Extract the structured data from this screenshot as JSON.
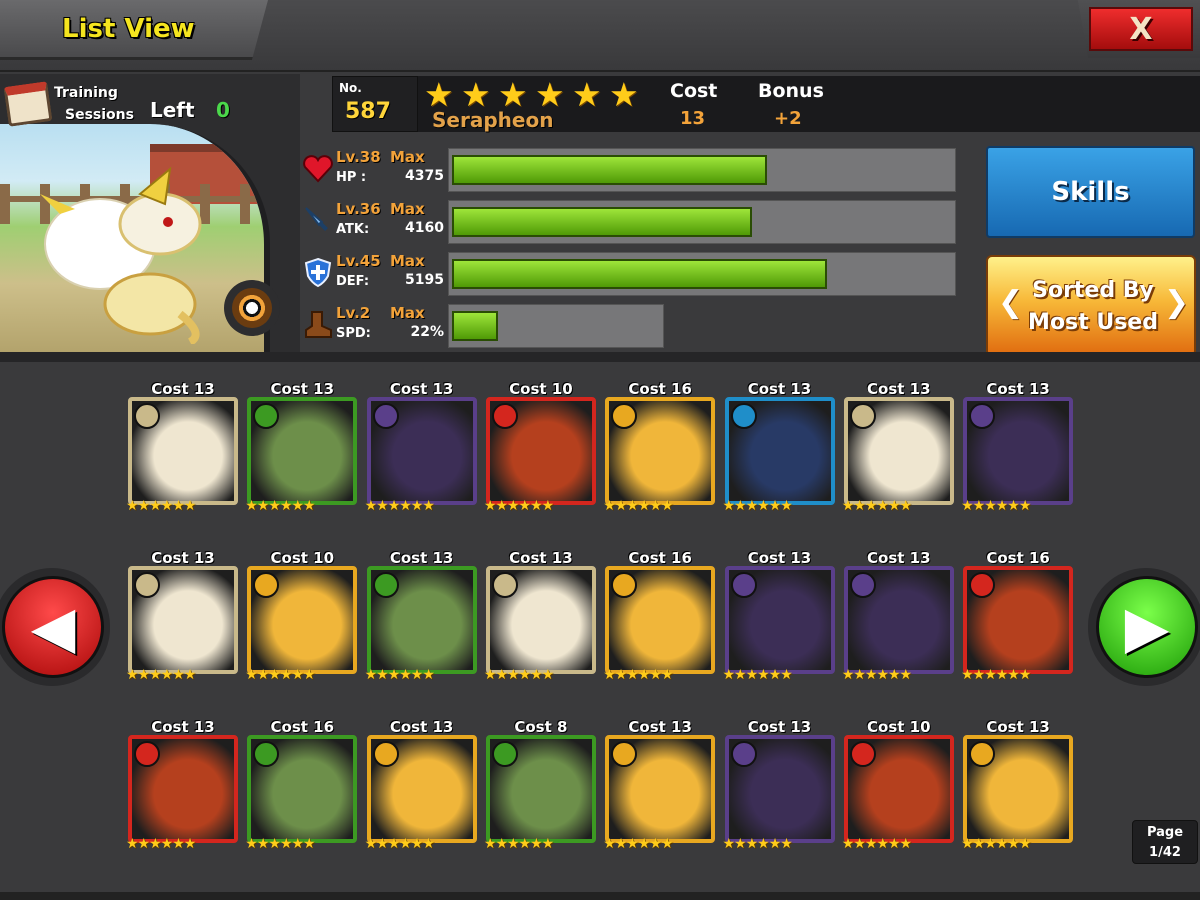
{
  "header": {
    "title": "List View",
    "close_label": "X"
  },
  "hero": {
    "training_label_1": "Training",
    "training_label_2": "Sessions",
    "left_label": "Left",
    "left_value": "0",
    "no_label": "No.",
    "no_value": "587",
    "stars": 6,
    "name": "Serapheon",
    "cost_label": "Cost",
    "cost_value": "13",
    "bonus_label": "Bonus",
    "bonus_value": "+2",
    "element_icon": "neutral-element-icon"
  },
  "stats": [
    {
      "key": "hp",
      "icon": "heart-icon",
      "level": "Lv.38",
      "max": "Max",
      "name": "HP :",
      "value": "4375",
      "fill": 0.63,
      "track": "long"
    },
    {
      "key": "atk",
      "icon": "sword-icon",
      "level": "Lv.36",
      "max": "Max",
      "name": "ATK:",
      "value": "4160",
      "fill": 0.6,
      "track": "long"
    },
    {
      "key": "def",
      "icon": "shield-icon",
      "level": "Lv.45",
      "max": "Max",
      "name": "DEF:",
      "value": "5195",
      "fill": 0.75,
      "track": "long"
    },
    {
      "key": "spd",
      "icon": "boot-icon",
      "level": "Lv.2",
      "max": "Max",
      "name": "SPD:",
      "value": "22%",
      "fill": 0.22,
      "track": "short"
    }
  ],
  "buttons": {
    "skills": "Skills",
    "sort_line1": "Sorted By",
    "sort_line2": "Most Used"
  },
  "pagination": {
    "label": "Page",
    "value": "1/42"
  },
  "colors": {
    "frame": {
      "neutral": "#c9b98a",
      "nature": "#3c9a22",
      "dark": "#5a3f8a",
      "fire": "#d4261e",
      "electric": "#e8a820",
      "water": "#1f8ec9"
    },
    "art": {
      "neutral": "#efe6d0",
      "nature": "#6d8f4a",
      "dark": "#3c2e56",
      "fire": "#b5401e",
      "electric": "#f0b63a",
      "water": "#283a66"
    }
  },
  "cards": [
    {
      "cost": "Cost 13",
      "element": "neutral",
      "stars": 6
    },
    {
      "cost": "Cost 13",
      "element": "nature",
      "stars": 6
    },
    {
      "cost": "Cost 13",
      "element": "dark",
      "stars": 6
    },
    {
      "cost": "Cost 10",
      "element": "fire",
      "stars": 6
    },
    {
      "cost": "Cost 16",
      "element": "electric",
      "stars": 6
    },
    {
      "cost": "Cost 13",
      "element": "water",
      "stars": 6
    },
    {
      "cost": "Cost 13",
      "element": "neutral",
      "stars": 6
    },
    {
      "cost": "Cost 13",
      "element": "dark",
      "stars": 6
    },
    {
      "cost": "Cost 13",
      "element": "neutral",
      "stars": 6
    },
    {
      "cost": "Cost 10",
      "element": "electric",
      "stars": 6
    },
    {
      "cost": "Cost 13",
      "element": "nature",
      "stars": 6
    },
    {
      "cost": "Cost 13",
      "element": "neutral",
      "stars": 6
    },
    {
      "cost": "Cost 16",
      "element": "electric",
      "stars": 6
    },
    {
      "cost": "Cost 13",
      "element": "dark",
      "stars": 6
    },
    {
      "cost": "Cost 13",
      "element": "dark",
      "stars": 6
    },
    {
      "cost": "Cost 16",
      "element": "fire",
      "stars": 6
    },
    {
      "cost": "Cost 13",
      "element": "fire",
      "stars": 6
    },
    {
      "cost": "Cost 16",
      "element": "nature",
      "stars": 6
    },
    {
      "cost": "Cost 13",
      "element": "electric",
      "stars": 6
    },
    {
      "cost": "Cost 8",
      "element": "nature",
      "stars": 6
    },
    {
      "cost": "Cost 13",
      "element": "electric",
      "stars": 6
    },
    {
      "cost": "Cost 13",
      "element": "dark",
      "stars": 6
    },
    {
      "cost": "Cost 10",
      "element": "fire",
      "stars": 6
    },
    {
      "cost": "Cost 13",
      "element": "electric",
      "stars": 6
    }
  ]
}
